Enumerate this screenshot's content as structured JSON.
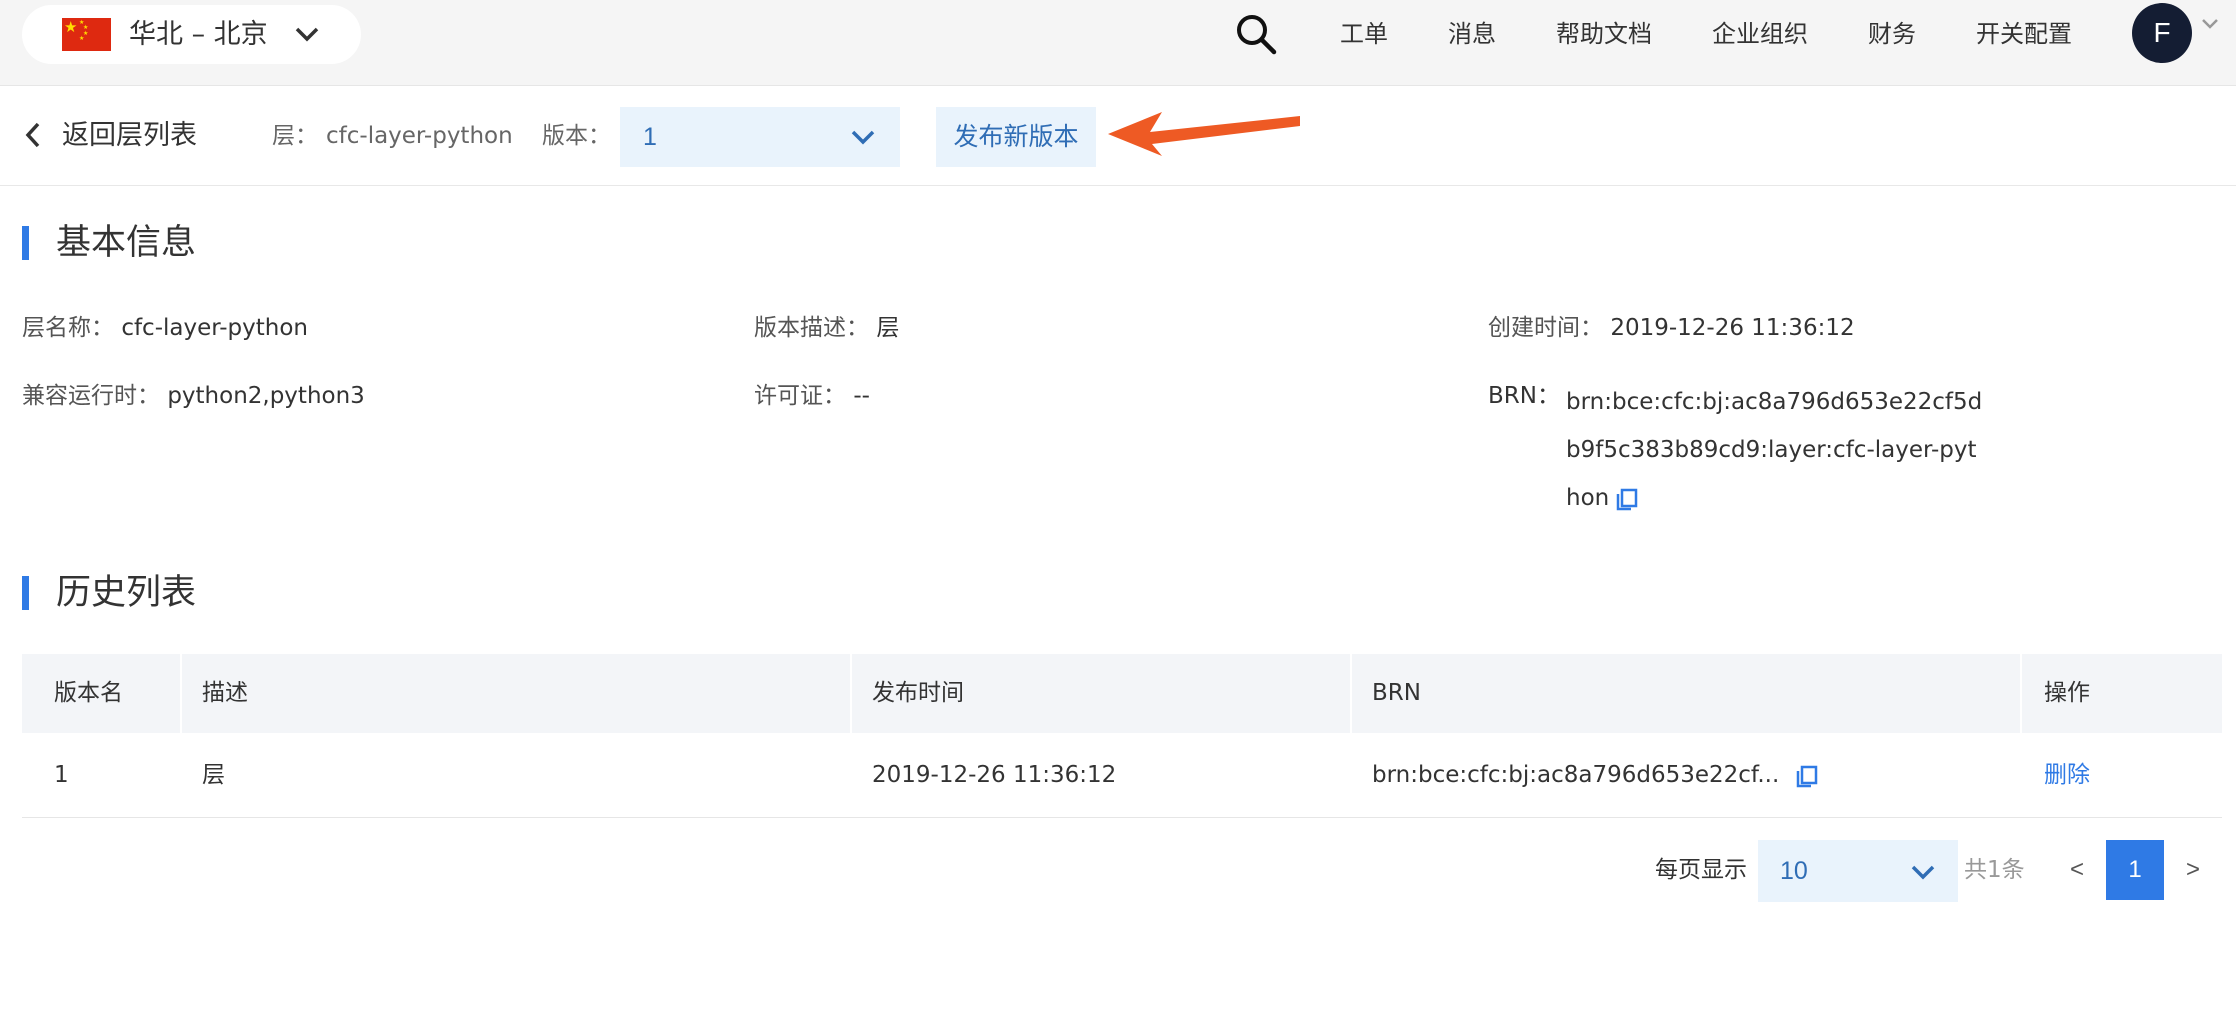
{
  "topbar": {
    "region": "华北 – 北京",
    "nav": [
      "工单",
      "消息",
      "帮助文档",
      "企业组织",
      "财务",
      "开关配置"
    ],
    "avatar_letter": "F"
  },
  "toolbar": {
    "back_label": "返回层列表",
    "layer_label": "层：",
    "layer_value": "cfc-layer-python",
    "version_label": "版本：",
    "version_value": "1",
    "publish_label": "发布新版本"
  },
  "basic": {
    "title": "基本信息",
    "name_label": "层名称：",
    "name_value": "cfc-layer-python",
    "desc_label": "版本描述：",
    "desc_value": "层",
    "created_label": "创建时间：",
    "created_value": "2019-12-26 11:36:12",
    "runtime_label": "兼容运行时：",
    "runtime_value": "python2,python3",
    "license_label": "许可证：",
    "license_value": "--",
    "brn_label": "BRN：",
    "brn_value": "brn:bce:cfc:bj:ac8a796d653e22cf5db9f5c383b89cd9:layer:cfc-layer-python"
  },
  "history": {
    "title": "历史列表",
    "columns": [
      "版本名",
      "描述",
      "发布时间",
      "BRN",
      "操作"
    ],
    "rows": [
      {
        "version": "1",
        "desc": "层",
        "time": "2019-12-26 11:36:12",
        "brn": "brn:bce:cfc:bj:ac8a796d653e22cf...",
        "action": "删除"
      }
    ]
  },
  "pagination": {
    "per_page_label": "每页显示",
    "per_page_value": "10",
    "total": "共1条",
    "prev": "<",
    "current": "1",
    "next": ">"
  },
  "colors": {
    "accent": "#2f7ae5",
    "select_bg": "#e9f3fc",
    "annotation_arrow": "#ee5a24"
  }
}
